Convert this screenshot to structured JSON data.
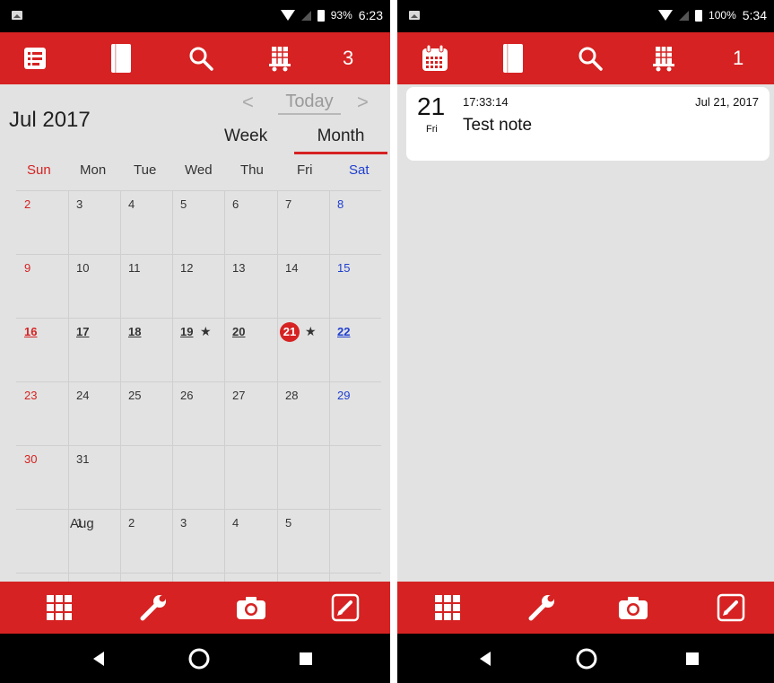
{
  "left": {
    "status": {
      "battery": "93%",
      "time": "6:23"
    },
    "toolbar": {
      "icons": [
        "list-icon",
        "notebook-icon",
        "search-icon",
        "shopping-cart-icon"
      ],
      "count": "3"
    },
    "calendar": {
      "month_title": "Jul 2017",
      "prev": "<",
      "today": "Today",
      "next": ">",
      "tab_week": "Week",
      "tab_month": "Month",
      "weekdays": [
        "Sun",
        "Mon",
        "Tue",
        "Wed",
        "Thu",
        "Fri",
        "Sat"
      ],
      "weeks": [
        [
          "2",
          "3",
          "4",
          "5",
          "6",
          "7",
          "8"
        ],
        [
          "9",
          "10",
          "11",
          "12",
          "13",
          "14",
          "15"
        ],
        [
          "16",
          "17",
          "18",
          "19",
          "20",
          "21",
          "22"
        ],
        [
          "23",
          "24",
          "25",
          "26",
          "27",
          "28",
          "29"
        ],
        [
          "30",
          "31",
          "",
          "",
          "",
          "",
          ""
        ],
        [
          "",
          "1",
          "2",
          "3",
          "4",
          "5"
        ]
      ],
      "current_week_days": [
        "16",
        "17",
        "18",
        "19",
        "20",
        "21",
        "22"
      ],
      "today_day": "21",
      "starred_days": [
        "19",
        "21"
      ],
      "star_glyph": "★",
      "next_month_label": "Aug"
    },
    "bottom": {
      "icons": [
        "grid-icon",
        "wrench-icon",
        "camera-icon",
        "edit-icon"
      ]
    }
  },
  "right": {
    "status": {
      "battery": "100%",
      "time": "5:34"
    },
    "toolbar": {
      "icons": [
        "calendar-icon",
        "notebook-icon",
        "search-icon",
        "shopping-cart-icon"
      ],
      "count": "1"
    },
    "note": {
      "day": "21",
      "weekday": "Fri",
      "time": "17:33:14",
      "text": "Test note",
      "date": "Jul 21, 2017"
    },
    "bottom": {
      "icons": [
        "grid-icon",
        "wrench-icon",
        "camera-icon",
        "edit-icon"
      ]
    }
  },
  "colors": {
    "accent": "#d62222",
    "sunday": "#d62222",
    "saturday": "#1f3fd0",
    "background": "#e2e2e2"
  }
}
